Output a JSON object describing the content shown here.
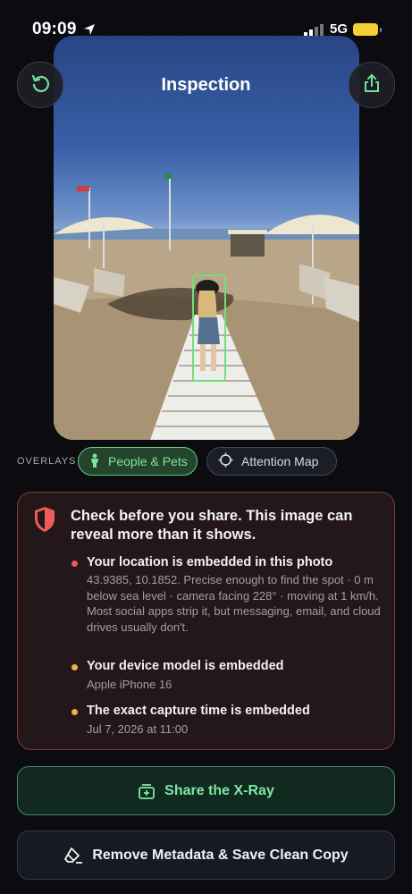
{
  "status_bar": {
    "time": "09:09",
    "network": "5G"
  },
  "header": {
    "title": "Inspection"
  },
  "overlays": {
    "label": "OVERLAYS",
    "chips": [
      {
        "label": "People & Pets",
        "active": true,
        "icon": "person-icon"
      },
      {
        "label": "Attention Map",
        "active": false,
        "icon": "crosshair-icon"
      }
    ]
  },
  "warning": {
    "title": "Check before you share. This image can reveal more than it shows.",
    "items": [
      {
        "title": "Your location is embedded in this photo",
        "text": "43.9385, 10.1852. Precise enough to find the spot · 0 m below sea level · camera facing 228° · moving at 1 km/h. Most social apps strip it, but messaging, email, and cloud drives usually don't.",
        "color": "#ef5b5b"
      },
      {
        "title": "Your device model is embedded",
        "text": "Apple iPhone 16",
        "color": "#f0b14a"
      },
      {
        "title": "The exact capture time is embedded",
        "text": "Jul 7, 2026 at 11:00",
        "color": "#f0b14a"
      }
    ]
  },
  "actions": {
    "share_label": "Share the X-Ray",
    "remove_label": "Remove Metadata & Save Clean Copy"
  },
  "colors": {
    "accent_green": "#7ee8a7",
    "danger": "#ef5b5b",
    "warn": "#f0b14a",
    "battery": "#f5d033"
  }
}
